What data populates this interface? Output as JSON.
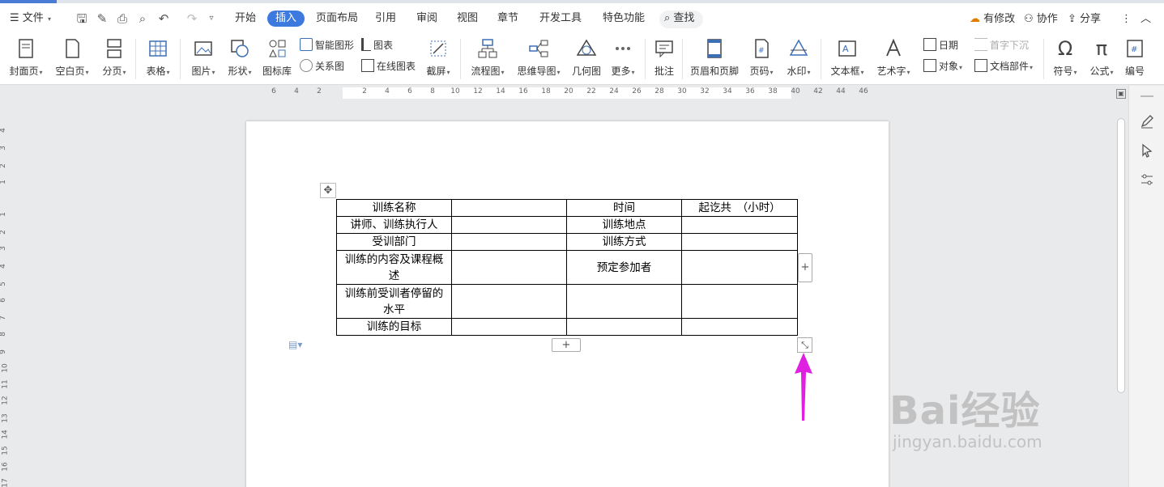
{
  "menu": {
    "file_label": "文件",
    "tabs": [
      "开始",
      "插入",
      "页面布局",
      "引用",
      "审阅",
      "视图",
      "章节",
      "开发工具",
      "特色功能"
    ],
    "active_tab": "插入",
    "search_label": "查找",
    "right": {
      "modified": "有修改",
      "collab": "协作",
      "share": "分享"
    }
  },
  "ribbon": {
    "cover": "封面页",
    "blank": "空白页",
    "pagebreak": "分页",
    "table": "表格",
    "picture": "图片",
    "shape": "形状",
    "iconlib": "图标库",
    "smart_shape": "智能图形",
    "chart": "图表",
    "relation": "关系图",
    "online_chart": "在线图表",
    "screenshot": "截屏",
    "flowchart": "流程图",
    "mindmap": "思维导图",
    "geometry": "几何图",
    "more": "更多",
    "comment": "批注",
    "header_footer": "页眉和页脚",
    "page_num": "页码",
    "watermark": "水印",
    "textbox": "文本框",
    "wordart": "艺术字",
    "date": "日期",
    "object": "对象",
    "dropcap": "首字下沉",
    "doc_parts": "文档部件",
    "symbol": "符号",
    "formula": "公式",
    "numbering": "编号"
  },
  "ruler": {
    "h_ticks": [
      "6",
      "4",
      "2",
      "2",
      "4",
      "6",
      "8",
      "10",
      "12",
      "14",
      "16",
      "18",
      "20",
      "22",
      "24",
      "26",
      "28",
      "30",
      "32",
      "34",
      "36",
      "38",
      "40",
      "42",
      "44",
      "46"
    ],
    "v_ticks": [
      "4",
      "3",
      "2",
      "1",
      "1",
      "2",
      "3",
      "4",
      "5",
      "6",
      "7",
      "8",
      "9",
      "10",
      "11",
      "12",
      "13",
      "14",
      "15",
      "16",
      "17"
    ]
  },
  "table": {
    "rows": [
      [
        "训练名称",
        "",
        "时间",
        "起讫共　（小时）"
      ],
      [
        "讲师、训练执行人",
        "",
        "训练地点",
        ""
      ],
      [
        "受训部门",
        "",
        "训练方式",
        ""
      ],
      [
        "训练的内容及课程概述",
        "",
        "预定参加者",
        ""
      ],
      [
        "训练前受训者停留的水平",
        "",
        "",
        ""
      ],
      [
        "训练的目标",
        "",
        "",
        ""
      ]
    ]
  },
  "controls": {
    "add_row": "+",
    "add_col": "+"
  },
  "watermark": {
    "brand": "Bai经验",
    "url": "jingyan.baidu.com"
  },
  "colors": {
    "accent": "#3d7ae0",
    "arrow": "#e020e0"
  }
}
